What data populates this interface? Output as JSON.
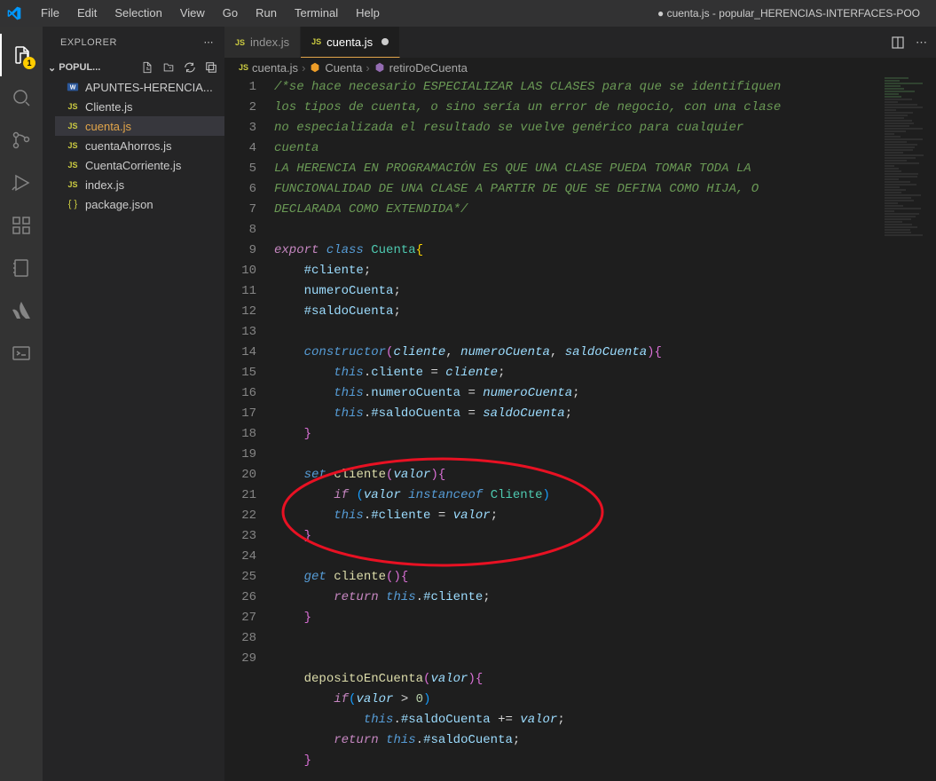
{
  "window": {
    "title_prefix": "●",
    "title_file": "cuenta.js",
    "title_project": "popular_HERENCIAS-INTERFACES-POO"
  },
  "menu": [
    "File",
    "Edit",
    "Selection",
    "View",
    "Go",
    "Run",
    "Terminal",
    "Help"
  ],
  "activity_bar": {
    "badge": "1"
  },
  "sidebar": {
    "title": "EXPLORER",
    "folder": "POPUL...",
    "files": [
      {
        "name": "APUNTES-HERENCIA...",
        "type": "word",
        "active": false
      },
      {
        "name": "Cliente.js",
        "type": "js",
        "active": false
      },
      {
        "name": "cuenta.js",
        "type": "js",
        "active": true
      },
      {
        "name": "cuentaAhorros.js",
        "type": "js",
        "active": false
      },
      {
        "name": "CuentaCorriente.js",
        "type": "js",
        "active": false
      },
      {
        "name": "index.js",
        "type": "js",
        "active": false
      },
      {
        "name": "package.json",
        "type": "json",
        "active": false
      }
    ]
  },
  "tabs": [
    {
      "label": "index.js",
      "active": false,
      "dirty": false
    },
    {
      "label": "cuenta.js",
      "active": true,
      "dirty": true
    }
  ],
  "breadcrumbs": [
    {
      "icon": "js",
      "label": "cuenta.js"
    },
    {
      "icon": "class",
      "label": "Cuenta"
    },
    {
      "icon": "method",
      "label": "retiroDeCuenta"
    }
  ],
  "code": {
    "lines": [
      "/*se hace necesario ESPECIALIZAR LAS CLASES para que se identifiquen",
      "los tipos de cuenta, o sino sería un error de negocio, con una clase",
      "no especializada el resultado se vuelve genérico para cualquier",
      "cuenta",
      "LA HERENCIA EN PROGRAMACIÓN ES QUE UNA CLASE PUEDA TOMAR TODA LA",
      "FUNCIONALIDAD DE UNA CLASE A PARTIR DE QUE SE DEFINA COMO HIJA, O",
      "DECLARADA COMO EXTENDIDA*/",
      "",
      "export class Cuenta{",
      "    #cliente;",
      "    numeroCuenta;",
      "    #saldoCuenta;",
      "",
      "    constructor(cliente, numeroCuenta, saldoCuenta){",
      "        this.cliente = cliente;",
      "        this.numeroCuenta = numeroCuenta;",
      "        this.#saldoCuenta = saldoCuenta;",
      "    }",
      "",
      "    set cliente(valor){",
      "        if (valor instanceof Cliente)",
      "        this.#cliente = valor;",
      "    }",
      "",
      "    get cliente(){",
      "        return this.#cliente;",
      "    }",
      "",
      "",
      "    depositoEnCuenta(valor){",
      "        if(valor > 0)",
      "            this.#saldoCuenta += valor;",
      "        return this.#saldoCuenta;",
      "    }"
    ],
    "line_numbers": [
      1,
      null,
      null,
      null,
      2,
      null,
      null,
      3,
      4,
      5,
      6,
      7,
      8,
      9,
      10,
      11,
      12,
      13,
      14,
      15,
      16,
      17,
      18,
      19,
      20,
      21,
      22,
      23,
      24,
      25,
      26,
      27,
      28,
      29
    ]
  },
  "colors": {
    "accent": "#e2a54a",
    "annotation": "#e81123"
  }
}
